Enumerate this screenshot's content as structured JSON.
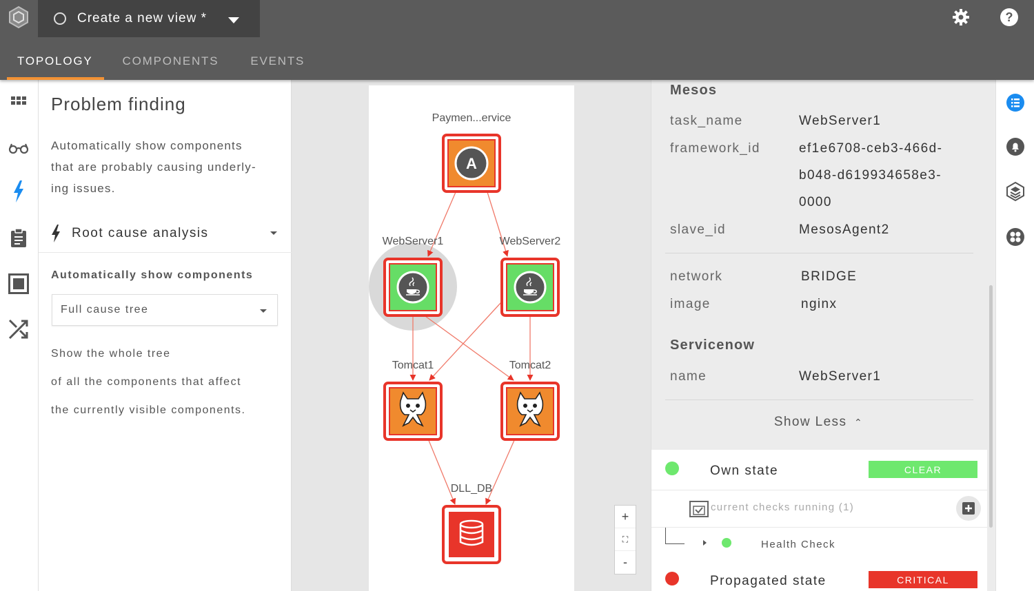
{
  "header": {
    "view_title": "Create a new view *",
    "tabs": [
      {
        "label": "TOPOLOGY",
        "active": true
      },
      {
        "label": "COMPONENTS",
        "active": false
      },
      {
        "label": "EVENTS",
        "active": false
      }
    ],
    "icons": [
      "logo-icon",
      "settings-icon",
      "help-icon"
    ]
  },
  "left_rail": {
    "icons": [
      "grid-icon",
      "glasses-icon",
      "lightning-icon",
      "clipboard-icon",
      "square-frame-icon",
      "shuffle-icon"
    ],
    "active_icon": "lightning-icon",
    "accent_color": "#1a8cf0"
  },
  "problem_panel": {
    "title": "Problem finding",
    "description_lines": [
      "Automatically show components",
      "that are probably causing underly-",
      "ing issues."
    ],
    "mode_label": "Root cause analysis",
    "auto_label": "Automatically show components",
    "selected_option": "Full cause tree",
    "help_lines": [
      "Show the whole tree",
      "of all the components that affect",
      "the currently visible components."
    ]
  },
  "topology": {
    "nodes": [
      {
        "id": "payment",
        "label": "Paymen...ervice",
        "icon": "a-badge-icon",
        "state": "critical"
      },
      {
        "id": "web1",
        "label": "WebServer1",
        "icon": "java-icon",
        "state": "clear",
        "selected": true
      },
      {
        "id": "web2",
        "label": "WebServer2",
        "icon": "java-icon",
        "state": "clear"
      },
      {
        "id": "tomcat1",
        "label": "Tomcat1",
        "icon": "tomcat-icon",
        "state": "critical"
      },
      {
        "id": "tomcat2",
        "label": "Tomcat2",
        "icon": "tomcat-icon",
        "state": "critical"
      },
      {
        "id": "db",
        "label": "DLL_DB",
        "icon": "database-icon",
        "state": "critical"
      }
    ],
    "edges": [
      [
        "payment",
        "web1"
      ],
      [
        "payment",
        "web2"
      ],
      [
        "web1",
        "tomcat1"
      ],
      [
        "web1",
        "tomcat2"
      ],
      [
        "web2",
        "tomcat1"
      ],
      [
        "web2",
        "tomcat2"
      ],
      [
        "tomcat1",
        "db"
      ],
      [
        "tomcat2",
        "db"
      ]
    ],
    "zoom_controls": {
      "zoom_in": "+",
      "fit": "⛶",
      "zoom_out": "-"
    },
    "colors": {
      "critical": "#e8352a",
      "clear_fill": "#66dd66",
      "orange_fill": "#f08a2e",
      "edge": "#f07a6a"
    }
  },
  "details": {
    "mesos_heading": "Mesos",
    "mesos": [
      {
        "key": "task_name",
        "value": [
          "WebServer1"
        ]
      },
      {
        "key": "framework_id",
        "value": [
          "ef1e6708-ceb3-466d-",
          "b048-d619934658e3-",
          "0000"
        ]
      },
      {
        "key": "slave_id",
        "value": [
          "MesosAgent2"
        ]
      }
    ],
    "docker": [
      {
        "key": "network",
        "value": "BRIDGE"
      },
      {
        "key": "image",
        "value": "nginx"
      }
    ],
    "servicenow_heading": "Servicenow",
    "servicenow": [
      {
        "key": "name",
        "value": "WebServer1"
      }
    ],
    "show_less_label": "Show Less"
  },
  "states": {
    "own": {
      "label": "Own state",
      "badge": "CLEAR",
      "color": "#6ee86e"
    },
    "checks_label": "current checks running (1)",
    "health_check_label": "Health Check",
    "propagated": {
      "label": "Propagated state",
      "badge": "CRITICAL",
      "color": "#e8352a"
    }
  },
  "right_rail": {
    "icons": [
      "list-icon",
      "bell-icon",
      "layers-icon",
      "component-icon"
    ],
    "active_icon": "list-icon"
  }
}
